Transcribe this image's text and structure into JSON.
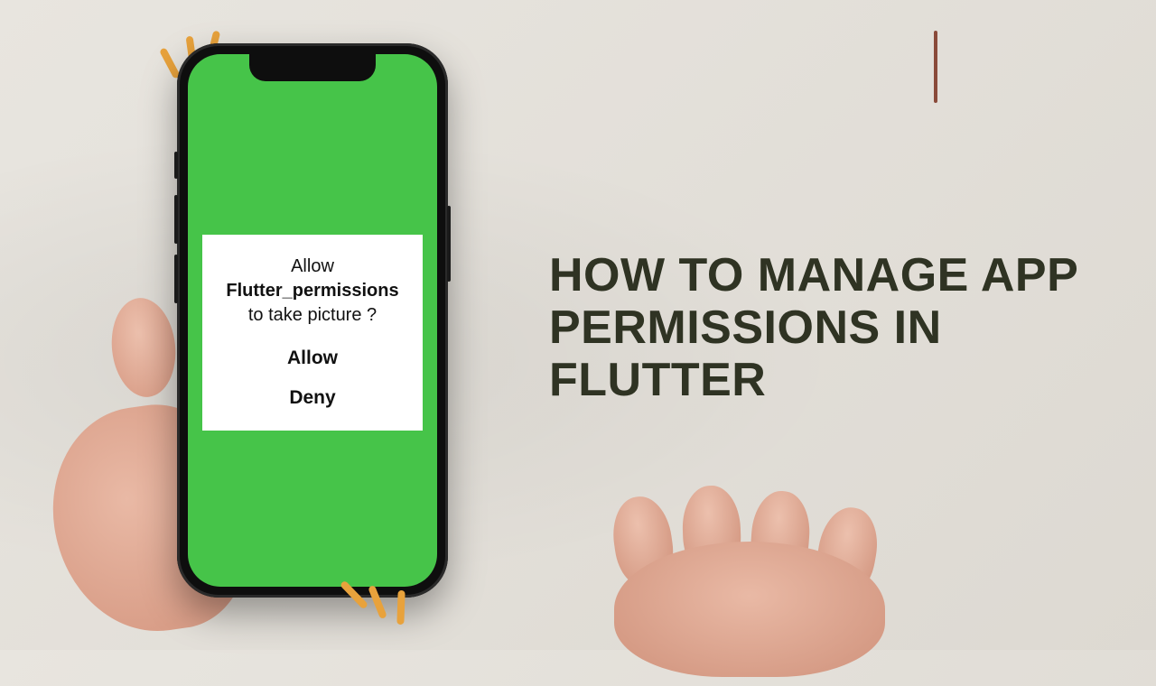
{
  "headline": "HOW TO MANAGE APP PERMISSIONS IN FLUTTER",
  "dialog": {
    "line1": "Allow",
    "line2": "Flutter_permissions",
    "line3": "to take  picture ?",
    "allow": "Allow",
    "deny": "Deny"
  }
}
